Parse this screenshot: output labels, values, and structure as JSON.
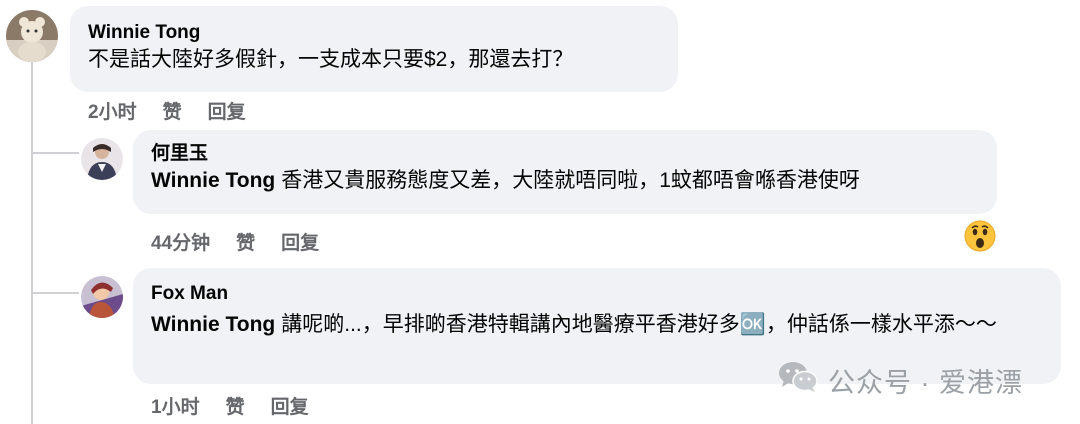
{
  "comments": [
    {
      "author": "Winnie Tong",
      "text": "不是話大陸好多假針，一支成本只要$2，那還去打？",
      "time": "2小时",
      "like": "赞",
      "reply": "回复"
    },
    {
      "author": "何里玉",
      "tag": "Winnie Tong",
      "text": "香港又貴服務態度又差，大陸就唔同啦，1蚊都唔會喺香港使呀",
      "time": "44分钟",
      "like": "赞",
      "reply": "回复",
      "reaction": "wow-emoji"
    },
    {
      "author": "Fox Man",
      "tag": "Winnie Tong",
      "text": "講呢啲...，早排啲香港特輯講內地醫療平香港好多🆗，仲話係一樣水平添～～",
      "time": "1小时",
      "like": "赞",
      "reply": "回复"
    }
  ],
  "watermark": {
    "text": "公众号 · 爱港漂",
    "icon": "wechat-icon"
  }
}
